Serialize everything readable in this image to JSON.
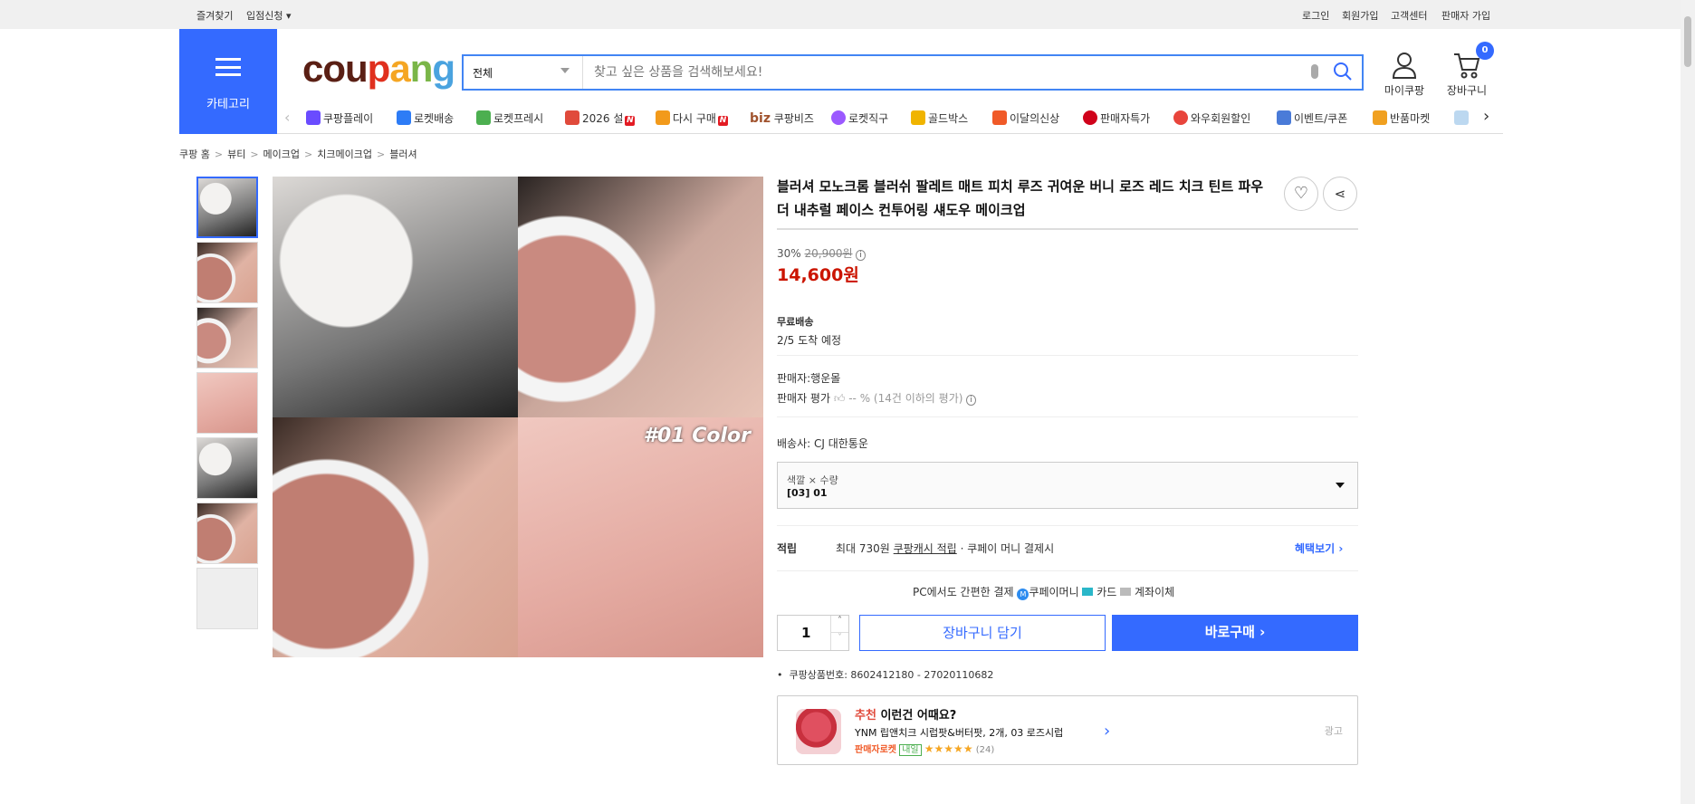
{
  "topbar": {
    "left": [
      "즐겨찾기",
      "입점신청"
    ],
    "right": [
      "로그인",
      "회원가입",
      "고객센터",
      "판매자 가입"
    ]
  },
  "header": {
    "category_label": "카테고리",
    "logo": "coupang",
    "search_scope": "전체",
    "search_placeholder": "찾고 싶은 상품을 검색해보세요!",
    "mypage": "마이쿠팡",
    "cart": "장바구니",
    "cart_count": "0"
  },
  "nav": [
    {
      "label": "쿠팡플레이",
      "color": "#6a4cff"
    },
    {
      "label": "로켓배송",
      "color": "#2d7cf6"
    },
    {
      "label": "로켓프레시",
      "color": "#4caf50"
    },
    {
      "label": "2026 설",
      "color": "#e04a3b",
      "new": "N"
    },
    {
      "label": "다시 구매",
      "color": "#f29a1b",
      "new": "N"
    },
    {
      "label": "쿠팡비즈",
      "color": "#a0522d",
      "prefix": "biz"
    },
    {
      "label": "로켓직구",
      "color": "#9b59ff"
    },
    {
      "label": "골드박스",
      "color": "#f0b400"
    },
    {
      "label": "이달의신상",
      "color": "#f05a28"
    },
    {
      "label": "판매자특가",
      "color": "#d0021b"
    },
    {
      "label": "와우회원할인",
      "color": "#e8453c"
    },
    {
      "label": "이벤트/쿠폰",
      "color": "#4a7bd8"
    },
    {
      "label": "반품마켓",
      "color": "#f0a020"
    }
  ],
  "breadcrumb": [
    "쿠팡 홈",
    "뷰티",
    "메이크업",
    "치크메이크업",
    "블러셔"
  ],
  "product": {
    "title": "블러셔 모노크롬 블러쉬 팔레트 매트 피치 루즈 귀여운 버니 로즈 레드 치크 틴트 파우더 내추럴 페이스 컨투어링 섀도우 메이크업",
    "image_text": "#01 Color",
    "discount": "30%",
    "original_price": "20,900원",
    "price": "14,600원",
    "shipping_title": "무료배송",
    "arrival": "2/5 도착 예정",
    "seller": "판매자:행운몰",
    "seller_rating_label": "판매자 평가",
    "seller_rating": "-- % (14건 이하의 평가)",
    "carrier": "배송사:  CJ 대한통운",
    "option_label": "색깔 × 수량",
    "option_value": "[03] 01",
    "reward_label": "적립",
    "reward_text1": "최대 730원",
    "reward_link": "쿠팡캐시 적립",
    "reward_text2": "· 쿠페이 머니 결제시",
    "benefit_link": "혜택보기",
    "pay_label": "PC에서도 간편한 결제",
    "pay_methods": [
      "쿠페이머니",
      "카드",
      "계좌이체"
    ],
    "quantity": "1",
    "add_cart": "장바구니 담기",
    "buy_now": "바로구매",
    "product_no": "쿠팡상품번호: 8602412180 - 27020110682"
  },
  "recommend": {
    "tag": "추천",
    "heading": "이런건 어때요?",
    "name": "YNM 립앤치크 시럽팟&버터팟, 2개, 03 로즈시럽",
    "badge": "판매자로켓",
    "badge2": "내일",
    "stars": "★★★★★",
    "reviews": "(24)",
    "ad": "광고"
  },
  "colors": {
    "accent": "#346aff",
    "price": "#cb1400"
  }
}
